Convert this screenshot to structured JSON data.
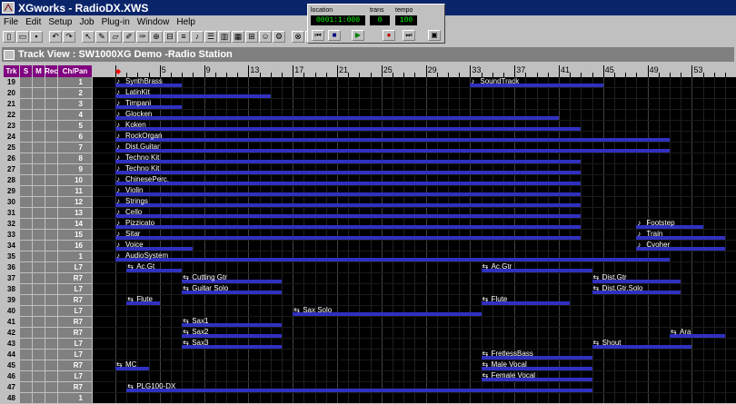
{
  "app": {
    "title": "XGworks - RadioDX.XWS"
  },
  "menu": [
    "File",
    "Edit",
    "Setup",
    "Job",
    "Plug-in",
    "Window",
    "Help"
  ],
  "toolbar": {
    "icons": [
      "new-icon",
      "open-icon",
      "save-icon",
      "undo-icon",
      "redo-icon",
      "pointer-icon",
      "pencil-icon",
      "eraser-icon",
      "brush-icon",
      "marker-icon",
      "zoom-icon",
      "split-icon",
      "mix-icon",
      "score-icon",
      "list-icon",
      "piano-icon",
      "grid-icon",
      "mixer-icon",
      "person-icon",
      "settings-icon",
      "link-icon",
      "tool-icon"
    ]
  },
  "transport": {
    "location_label": "location",
    "location_value": "0001:1:000",
    "trans_label": "trans",
    "trans_value": "0",
    "tempo_label": "tempo",
    "tempo_value": "100",
    "buttons": [
      "⏮",
      "■",
      "▶",
      "●",
      "⏭",
      "▣"
    ]
  },
  "track_view": {
    "title": "Track View : SW1000XG Demo -Radio Station",
    "headers": {
      "trk": "Trk",
      "s": "S",
      "m": "M",
      "rec": "Rec",
      "chpan": "Ch/Pan"
    },
    "ruler": [
      "5",
      "9",
      "13",
      "17",
      "21",
      "25",
      "29",
      "33",
      "37",
      "41",
      "45",
      "49",
      "53"
    ],
    "tracks": [
      {
        "num": "19",
        "ch": "1"
      },
      {
        "num": "20",
        "ch": "2"
      },
      {
        "num": "21",
        "ch": "3"
      },
      {
        "num": "22",
        "ch": "4"
      },
      {
        "num": "23",
        "ch": "5"
      },
      {
        "num": "24",
        "ch": "6"
      },
      {
        "num": "25",
        "ch": "7"
      },
      {
        "num": "26",
        "ch": "8"
      },
      {
        "num": "27",
        "ch": "9"
      },
      {
        "num": "28",
        "ch": "10"
      },
      {
        "num": "29",
        "ch": "11"
      },
      {
        "num": "30",
        "ch": "12"
      },
      {
        "num": "31",
        "ch": "13"
      },
      {
        "num": "32",
        "ch": "14"
      },
      {
        "num": "33",
        "ch": "15"
      },
      {
        "num": "34",
        "ch": "16"
      },
      {
        "num": "35",
        "ch": "1"
      },
      {
        "num": "36",
        "ch": "L7"
      },
      {
        "num": "37",
        "ch": "R7"
      },
      {
        "num": "38",
        "ch": "L7"
      },
      {
        "num": "39",
        "ch": "R7"
      },
      {
        "num": "40",
        "ch": "L7"
      },
      {
        "num": "41",
        "ch": "R7"
      },
      {
        "num": "42",
        "ch": "R7"
      },
      {
        "num": "43",
        "ch": "L7"
      },
      {
        "num": "44",
        "ch": "L7"
      },
      {
        "num": "45",
        "ch": "R7"
      },
      {
        "num": "46",
        "ch": "L7"
      },
      {
        "num": "47",
        "ch": "R7"
      },
      {
        "num": "48",
        "ch": "1"
      }
    ],
    "clips": [
      {
        "row": 0,
        "start": 1,
        "end": 7,
        "label": "SynthBrass",
        "type": "midi"
      },
      {
        "row": 0,
        "start": 33,
        "end": 45,
        "label": "SoundTrack",
        "type": "midi"
      },
      {
        "row": 1,
        "start": 1,
        "end": 15,
        "label": "LatinKit",
        "type": "midi"
      },
      {
        "row": 2,
        "start": 1,
        "end": 7,
        "label": "Timpani",
        "type": "midi"
      },
      {
        "row": 3,
        "start": 1,
        "end": 41,
        "label": "Glocken",
        "type": "midi"
      },
      {
        "row": 4,
        "start": 1,
        "end": 43,
        "label": "Koken",
        "type": "midi"
      },
      {
        "row": 5,
        "start": 1,
        "end": 51,
        "label": "RockOrgan",
        "type": "midi"
      },
      {
        "row": 6,
        "start": 1,
        "end": 51,
        "label": "Dist.Guitar",
        "type": "midi"
      },
      {
        "row": 7,
        "start": 1,
        "end": 43,
        "label": "Techno Kit",
        "type": "midi"
      },
      {
        "row": 8,
        "start": 1,
        "end": 43,
        "label": "Techno Kit",
        "type": "midi"
      },
      {
        "row": 9,
        "start": 1,
        "end": 43,
        "label": "ChinesePerc.",
        "type": "midi"
      },
      {
        "row": 10,
        "start": 1,
        "end": 43,
        "label": "Violin",
        "type": "midi"
      },
      {
        "row": 11,
        "start": 1,
        "end": 43,
        "label": "Strings",
        "type": "midi"
      },
      {
        "row": 12,
        "start": 1,
        "end": 43,
        "label": "Cello",
        "type": "midi"
      },
      {
        "row": 13,
        "start": 1,
        "end": 43,
        "label": "Pizzicato",
        "type": "midi"
      },
      {
        "row": 13,
        "start": 48,
        "end": 54,
        "label": "Footstep",
        "type": "midi"
      },
      {
        "row": 14,
        "start": 1,
        "end": 43,
        "label": "Sitar",
        "type": "midi"
      },
      {
        "row": 14,
        "start": 48,
        "end": 56,
        "label": "Train",
        "type": "midi"
      },
      {
        "row": 15,
        "start": 1,
        "end": 8,
        "label": "Voice",
        "type": "midi"
      },
      {
        "row": 15,
        "start": 48,
        "end": 56,
        "label": "Cvoher",
        "type": "midi"
      },
      {
        "row": 16,
        "start": 1,
        "end": 51,
        "label": "AudioSystem",
        "type": "midi"
      },
      {
        "row": 17,
        "start": 2,
        "end": 7,
        "label": "Ac.Gt",
        "type": "audio"
      },
      {
        "row": 17,
        "start": 34,
        "end": 44,
        "label": "Ac.Gtr",
        "type": "audio"
      },
      {
        "row": 18,
        "start": 7,
        "end": 16,
        "label": "Cutting Gtr",
        "type": "audio"
      },
      {
        "row": 18,
        "start": 44,
        "end": 52,
        "label": "Dist.Gtr",
        "type": "audio"
      },
      {
        "row": 19,
        "start": 7,
        "end": 16,
        "label": "Guitar Solo",
        "type": "audio"
      },
      {
        "row": 19,
        "start": 44,
        "end": 52,
        "label": "Dist.Gtr.Solo",
        "type": "audio"
      },
      {
        "row": 20,
        "start": 2,
        "end": 5,
        "label": "Flute",
        "type": "audio"
      },
      {
        "row": 20,
        "start": 34,
        "end": 42,
        "label": "Flute",
        "type": "audio"
      },
      {
        "row": 21,
        "start": 17,
        "end": 34,
        "label": "Sax Solo",
        "type": "audio"
      },
      {
        "row": 22,
        "start": 7,
        "end": 16,
        "label": "Sax1",
        "type": "audio"
      },
      {
        "row": 23,
        "start": 7,
        "end": 16,
        "label": "Sax2",
        "type": "audio"
      },
      {
        "row": 23,
        "start": 51,
        "end": 56,
        "label": "Ara",
        "type": "audio"
      },
      {
        "row": 24,
        "start": 7,
        "end": 16,
        "label": "Sax3",
        "type": "audio"
      },
      {
        "row": 24,
        "start": 44,
        "end": 53,
        "label": "Shout",
        "type": "audio"
      },
      {
        "row": 25,
        "start": 34,
        "end": 44,
        "label": "FretlessBass",
        "type": "audio"
      },
      {
        "row": 26,
        "start": 1,
        "end": 4,
        "label": "MC",
        "type": "audio"
      },
      {
        "row": 26,
        "start": 34,
        "end": 44,
        "label": "Male Vocal",
        "type": "audio"
      },
      {
        "row": 27,
        "start": 34,
        "end": 44,
        "label": "Female Vocal",
        "type": "audio"
      },
      {
        "row": 28,
        "start": 2,
        "end": 44,
        "label": "PLG100-DX",
        "type": "audio"
      }
    ]
  },
  "colors": {
    "titlebar": "#0a246a",
    "header": "#800080",
    "clip_bar": "#3030c0",
    "grid_bg": "#000000",
    "lcd_text": "#00ff00"
  }
}
